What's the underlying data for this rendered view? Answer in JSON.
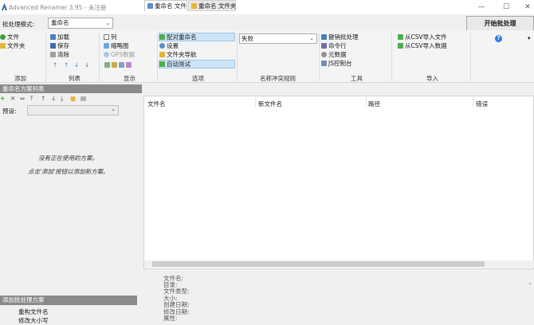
{
  "window": {
    "title": "Advanced Renamer 3.95 - 未注册",
    "minimize": "—",
    "maximize": "☐",
    "close": "✕"
  },
  "batch_mode": {
    "label": "批处理模式:",
    "value": "重命名"
  },
  "start_button": "开始批处理",
  "ribbon": {
    "add": {
      "items": [
        "文件",
        "文件夹"
      ],
      "label": "添加"
    },
    "list": {
      "items": [
        "加载",
        "保存",
        "清除"
      ],
      "arrows": [
        "↑",
        "↑",
        "↓",
        "↓"
      ],
      "label": "列表"
    },
    "display": {
      "items": [
        "列",
        "缩略图",
        "GPS数据"
      ],
      "label": "显示"
    },
    "options": {
      "items": [
        "配对重命名",
        "设置",
        "文件夹导航",
        "自动测试"
      ],
      "label": "选项"
    },
    "conflict": {
      "value": "失败",
      "label": "名称冲突规则"
    },
    "tools": {
      "items": [
        "撤销批处理",
        "命令行",
        "元数据",
        "JS控制台"
      ],
      "label": "工具"
    },
    "import": {
      "items": [
        "从CSV导入文件",
        "从CSV导入数据"
      ],
      "label": "导入"
    },
    "help_icon": "?"
  },
  "methods_panel": {
    "header": "重命名方案列表",
    "toolbar": [
      "+",
      "✕",
      "⇔",
      "⤒",
      "↑",
      "↓",
      "⤓",
      "■",
      "▤"
    ],
    "preset_label": "预设:",
    "empty_line1": "没有正在使用的方案。",
    "empty_line2": "点击'添加'按钮以添加新方案。"
  },
  "batch_panel": {
    "header": "添加批处理方案",
    "items": [
      "重构文件名",
      "修改大小写"
    ]
  },
  "tabs": [
    "重命名 文件",
    "重命名 文件夹"
  ],
  "columns": [
    "文件名",
    "新文件名",
    "路径",
    "错误"
  ],
  "info_fields": [
    "文件名:",
    "目录:",
    "文件类型:",
    "大小:",
    "创建日期:",
    "修改日期:",
    "属性:"
  ],
  "colors": {
    "accent": "#cde4f7",
    "panel_header": "#8a8a8a",
    "add_green": "#3aa53a",
    "help_blue": "#2a7de1"
  }
}
